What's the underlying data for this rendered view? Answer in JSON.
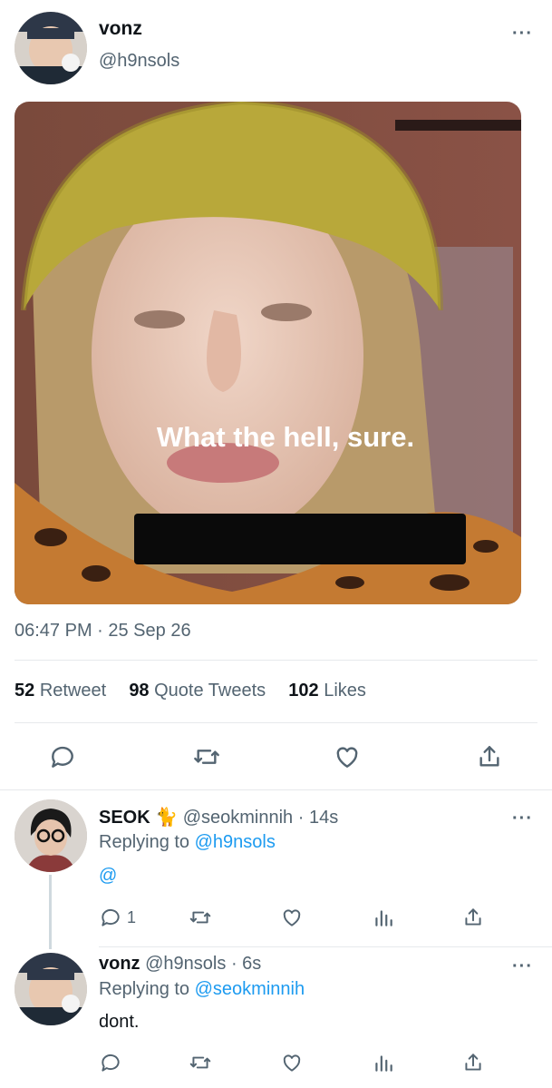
{
  "main_tweet": {
    "display_name": "vonz",
    "handle": "@h9nsols",
    "caption": "What the hell, sure.",
    "timestamp": "06:47 PM · 25 Sep 26",
    "retweets": "52",
    "retweets_label": "Retweet",
    "quotes": "98",
    "quotes_label": "Quote Tweets",
    "likes": "102",
    "likes_label": "Likes"
  },
  "replies": [
    {
      "display_name": "SEOK 🐈",
      "handle": "@seokminnih",
      "time": "· 14s",
      "replying_prefix": "Replying to",
      "replying_to": "@h9nsols",
      "text": "@",
      "reply_count": "1"
    },
    {
      "display_name": "vonz",
      "handle": "@h9nsols",
      "time": "· 6s",
      "replying_prefix": "Replying to",
      "replying_to": "@seokminnih",
      "text": "dont."
    }
  ],
  "icons": [
    "more-icon",
    "reply-icon",
    "retweet-icon",
    "like-icon",
    "share-icon",
    "analytics-icon"
  ],
  "colors": {
    "accent": "#1d9bf0",
    "secondary_text": "#536471",
    "divider": "#e6e9ec"
  }
}
